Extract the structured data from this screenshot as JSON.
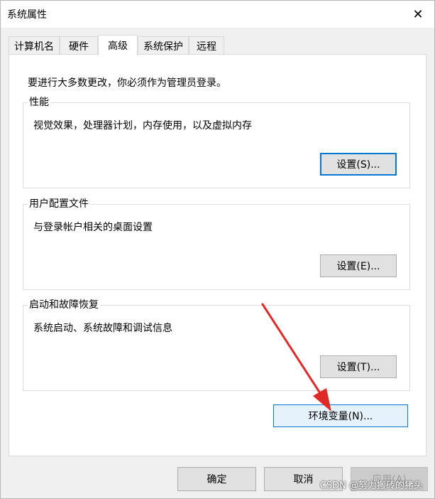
{
  "window": {
    "title": "系统属性",
    "close_glyph": "✕"
  },
  "tabs": [
    {
      "label": "计算机名"
    },
    {
      "label": "硬件"
    },
    {
      "label": "高级",
      "active": true
    },
    {
      "label": "系统保护"
    },
    {
      "label": "远程"
    }
  ],
  "panel": {
    "admin_note": "要进行大多数更改，你必须作为管理员登录。",
    "performance": {
      "title": "性能",
      "desc": "视觉效果，处理器计划，内存使用，以及虚拟内存",
      "button": "设置(S)..."
    },
    "user_profiles": {
      "title": "用户配置文件",
      "desc": "与登录帐户相关的桌面设置",
      "button": "设置(E)..."
    },
    "startup_recovery": {
      "title": "启动和故障恢复",
      "desc": "系统启动、系统故障和调试信息",
      "button": "设置(T)..."
    },
    "env_button": "环境变量(N)..."
  },
  "footer": {
    "ok": "确定",
    "cancel": "取消",
    "apply": "应用(A)"
  },
  "watermark": "CSDN @努力搬砖的猪头",
  "colors": {
    "accent": "#0078d7",
    "arrow": "#e02a2a"
  }
}
